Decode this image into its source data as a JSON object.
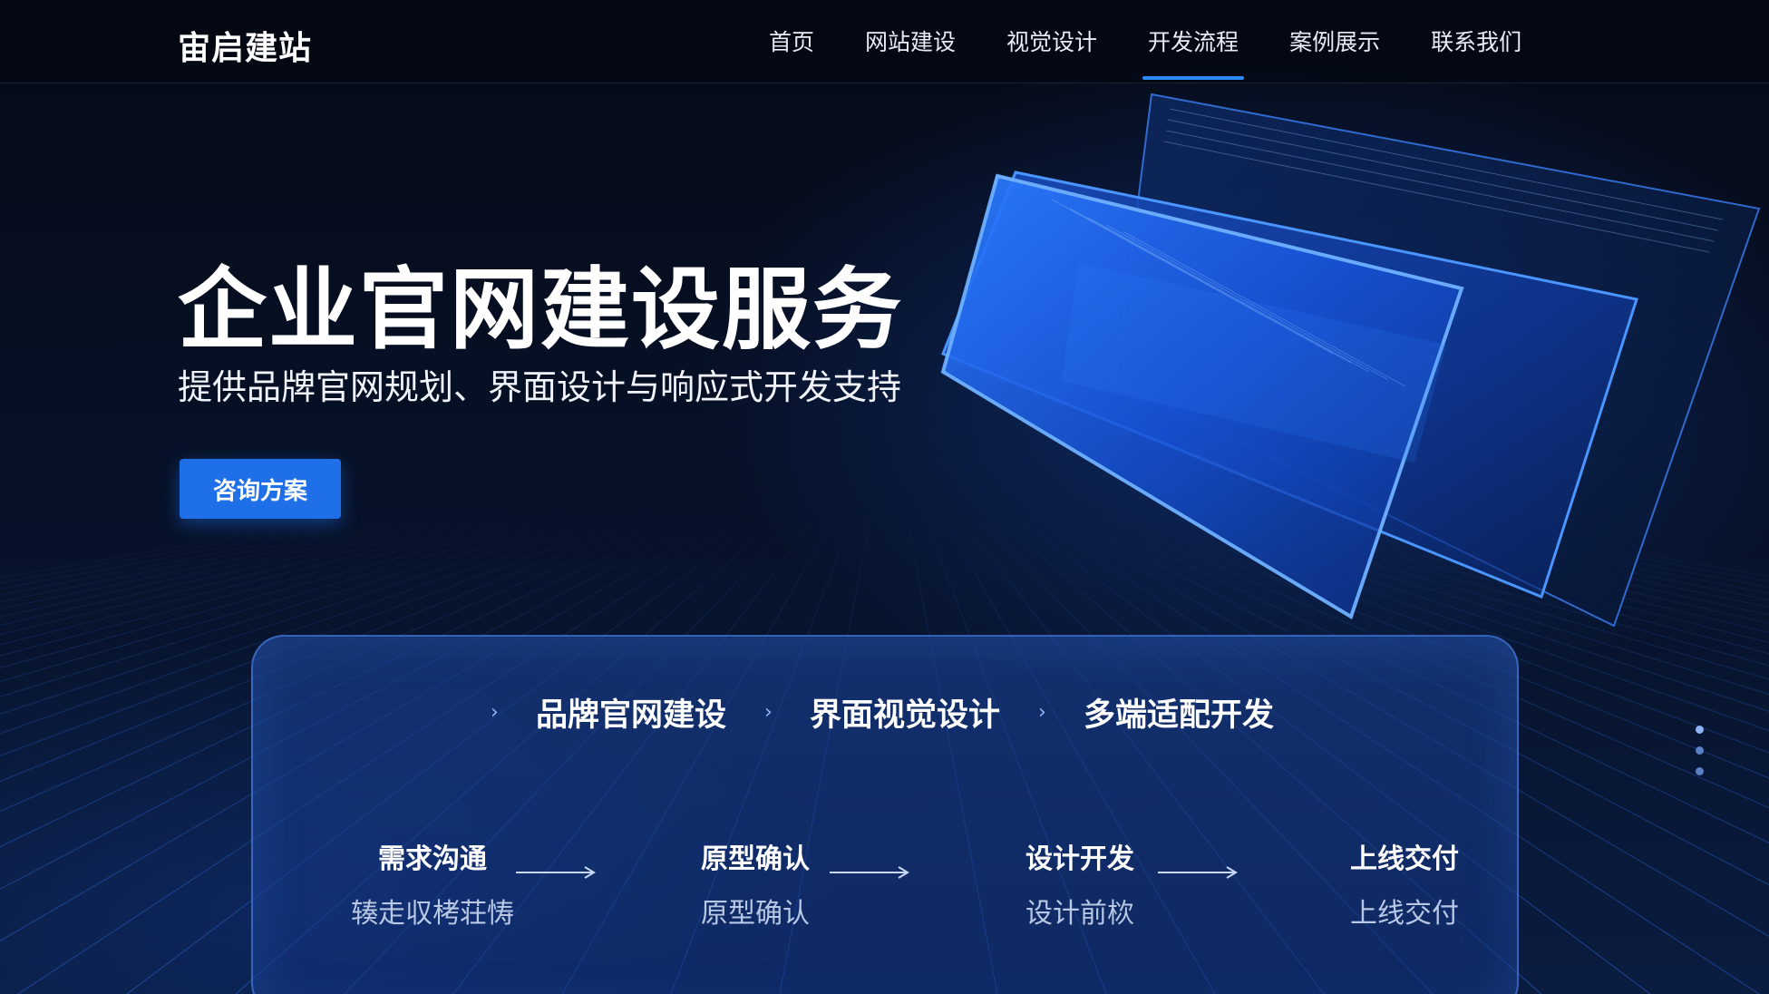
{
  "header": {
    "logo": "宙启建站",
    "nav": [
      {
        "label": "首页",
        "active": false
      },
      {
        "label": "网站建设",
        "active": false
      },
      {
        "label": "视觉设计",
        "active": false
      },
      {
        "label": "开发流程",
        "active": true
      },
      {
        "label": "案例展示",
        "active": false
      },
      {
        "label": "联系我们",
        "active": false
      }
    ]
  },
  "hero": {
    "title": "企业官网建设服务",
    "subtitle": "提供品牌官网规划、界面设计与响应式开发支持",
    "cta_label": "咨询方案"
  },
  "card": {
    "services": [
      "品牌官网建设",
      "界面视觉设计",
      "多端适配开发"
    ],
    "steps": [
      {
        "title": "需求沟通",
        "sub": "辏走収栲荘㤽"
      },
      {
        "title": "原型确认",
        "sub": "原型确认"
      },
      {
        "title": "设计开发",
        "sub": "设计前栨"
      },
      {
        "title": "上线交付",
        "sub": "上线交付"
      }
    ]
  },
  "colors": {
    "accent": "#1f6fe8",
    "nav_underline": "#2b8bff",
    "background": "#050b18",
    "card": "#1c48a0"
  },
  "icons": {
    "service_separator": "chevron-right-icon",
    "step_connector": "arrow-right-icon"
  },
  "pagination": {
    "count": 3,
    "active_index": 0
  }
}
